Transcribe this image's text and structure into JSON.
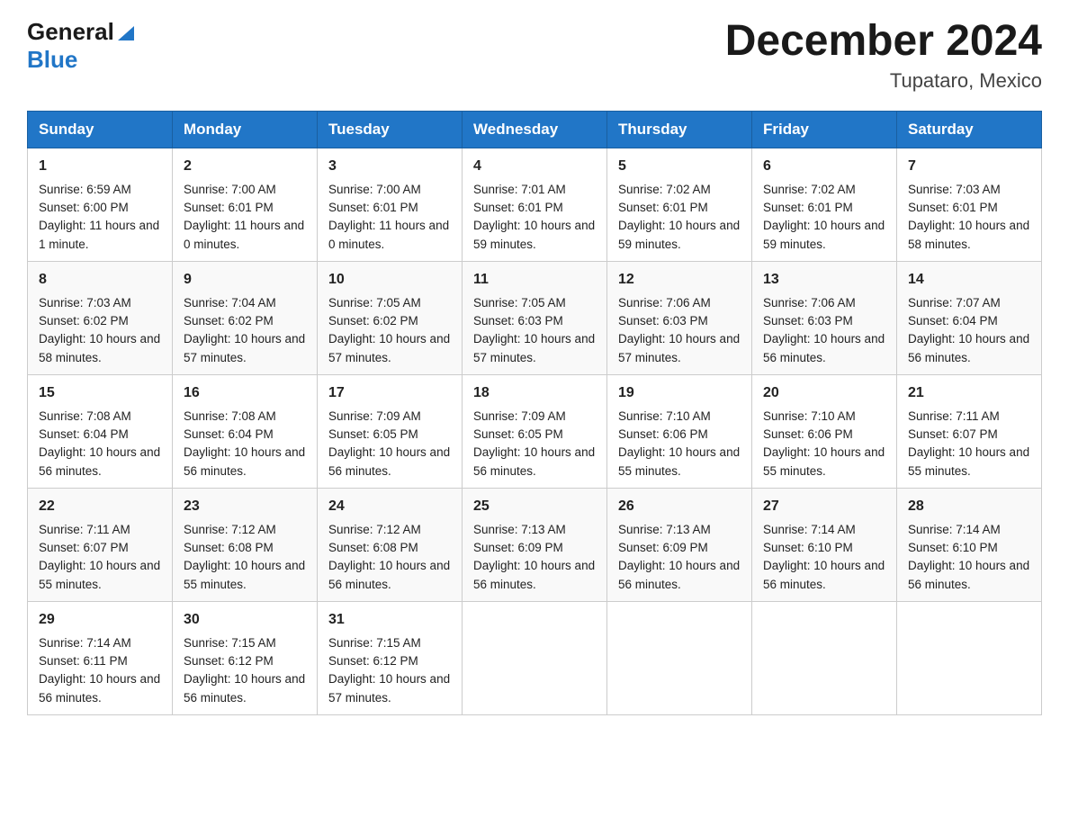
{
  "header": {
    "logo_general": "General",
    "logo_blue": "Blue",
    "month_title": "December 2024",
    "location": "Tupataro, Mexico"
  },
  "weekdays": [
    "Sunday",
    "Monday",
    "Tuesday",
    "Wednesday",
    "Thursday",
    "Friday",
    "Saturday"
  ],
  "weeks": [
    [
      {
        "day": "1",
        "sunrise": "6:59 AM",
        "sunset": "6:00 PM",
        "daylight": "11 hours and 1 minute."
      },
      {
        "day": "2",
        "sunrise": "7:00 AM",
        "sunset": "6:01 PM",
        "daylight": "11 hours and 0 minutes."
      },
      {
        "day": "3",
        "sunrise": "7:00 AM",
        "sunset": "6:01 PM",
        "daylight": "11 hours and 0 minutes."
      },
      {
        "day": "4",
        "sunrise": "7:01 AM",
        "sunset": "6:01 PM",
        "daylight": "10 hours and 59 minutes."
      },
      {
        "day": "5",
        "sunrise": "7:02 AM",
        "sunset": "6:01 PM",
        "daylight": "10 hours and 59 minutes."
      },
      {
        "day": "6",
        "sunrise": "7:02 AM",
        "sunset": "6:01 PM",
        "daylight": "10 hours and 59 minutes."
      },
      {
        "day": "7",
        "sunrise": "7:03 AM",
        "sunset": "6:01 PM",
        "daylight": "10 hours and 58 minutes."
      }
    ],
    [
      {
        "day": "8",
        "sunrise": "7:03 AM",
        "sunset": "6:02 PM",
        "daylight": "10 hours and 58 minutes."
      },
      {
        "day": "9",
        "sunrise": "7:04 AM",
        "sunset": "6:02 PM",
        "daylight": "10 hours and 57 minutes."
      },
      {
        "day": "10",
        "sunrise": "7:05 AM",
        "sunset": "6:02 PM",
        "daylight": "10 hours and 57 minutes."
      },
      {
        "day": "11",
        "sunrise": "7:05 AM",
        "sunset": "6:03 PM",
        "daylight": "10 hours and 57 minutes."
      },
      {
        "day": "12",
        "sunrise": "7:06 AM",
        "sunset": "6:03 PM",
        "daylight": "10 hours and 57 minutes."
      },
      {
        "day": "13",
        "sunrise": "7:06 AM",
        "sunset": "6:03 PM",
        "daylight": "10 hours and 56 minutes."
      },
      {
        "day": "14",
        "sunrise": "7:07 AM",
        "sunset": "6:04 PM",
        "daylight": "10 hours and 56 minutes."
      }
    ],
    [
      {
        "day": "15",
        "sunrise": "7:08 AM",
        "sunset": "6:04 PM",
        "daylight": "10 hours and 56 minutes."
      },
      {
        "day": "16",
        "sunrise": "7:08 AM",
        "sunset": "6:04 PM",
        "daylight": "10 hours and 56 minutes."
      },
      {
        "day": "17",
        "sunrise": "7:09 AM",
        "sunset": "6:05 PM",
        "daylight": "10 hours and 56 minutes."
      },
      {
        "day": "18",
        "sunrise": "7:09 AM",
        "sunset": "6:05 PM",
        "daylight": "10 hours and 56 minutes."
      },
      {
        "day": "19",
        "sunrise": "7:10 AM",
        "sunset": "6:06 PM",
        "daylight": "10 hours and 55 minutes."
      },
      {
        "day": "20",
        "sunrise": "7:10 AM",
        "sunset": "6:06 PM",
        "daylight": "10 hours and 55 minutes."
      },
      {
        "day": "21",
        "sunrise": "7:11 AM",
        "sunset": "6:07 PM",
        "daylight": "10 hours and 55 minutes."
      }
    ],
    [
      {
        "day": "22",
        "sunrise": "7:11 AM",
        "sunset": "6:07 PM",
        "daylight": "10 hours and 55 minutes."
      },
      {
        "day": "23",
        "sunrise": "7:12 AM",
        "sunset": "6:08 PM",
        "daylight": "10 hours and 55 minutes."
      },
      {
        "day": "24",
        "sunrise": "7:12 AM",
        "sunset": "6:08 PM",
        "daylight": "10 hours and 56 minutes."
      },
      {
        "day": "25",
        "sunrise": "7:13 AM",
        "sunset": "6:09 PM",
        "daylight": "10 hours and 56 minutes."
      },
      {
        "day": "26",
        "sunrise": "7:13 AM",
        "sunset": "6:09 PM",
        "daylight": "10 hours and 56 minutes."
      },
      {
        "day": "27",
        "sunrise": "7:14 AM",
        "sunset": "6:10 PM",
        "daylight": "10 hours and 56 minutes."
      },
      {
        "day": "28",
        "sunrise": "7:14 AM",
        "sunset": "6:10 PM",
        "daylight": "10 hours and 56 minutes."
      }
    ],
    [
      {
        "day": "29",
        "sunrise": "7:14 AM",
        "sunset": "6:11 PM",
        "daylight": "10 hours and 56 minutes."
      },
      {
        "day": "30",
        "sunrise": "7:15 AM",
        "sunset": "6:12 PM",
        "daylight": "10 hours and 56 minutes."
      },
      {
        "day": "31",
        "sunrise": "7:15 AM",
        "sunset": "6:12 PM",
        "daylight": "10 hours and 57 minutes."
      },
      null,
      null,
      null,
      null
    ]
  ],
  "labels": {
    "sunrise": "Sunrise:",
    "sunset": "Sunset:",
    "daylight": "Daylight:"
  }
}
